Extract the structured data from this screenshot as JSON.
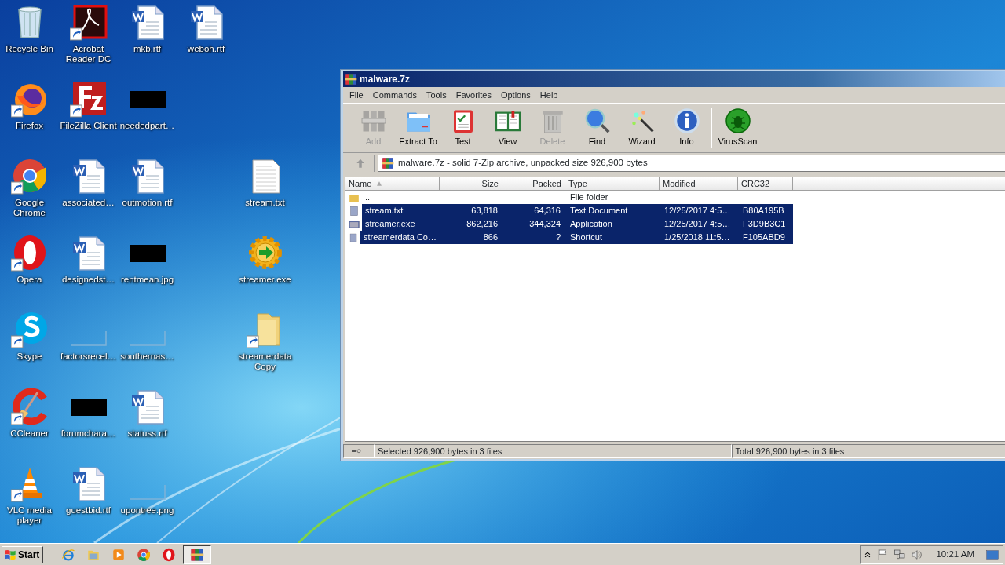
{
  "desktop_columns": [
    [
      {
        "label": "Recycle Bin",
        "kind": "recycle",
        "shortcut": false
      },
      {
        "label": "Firefox",
        "kind": "firefox",
        "shortcut": true
      },
      {
        "label": "Google Chrome",
        "kind": "chrome",
        "shortcut": true
      },
      {
        "label": "Opera",
        "kind": "opera",
        "shortcut": true
      },
      {
        "label": "Skype",
        "kind": "skype",
        "shortcut": true
      },
      {
        "label": "CCleaner",
        "kind": "ccleaner",
        "shortcut": true
      },
      {
        "label": "VLC media player",
        "kind": "vlc",
        "shortcut": true
      }
    ],
    [
      {
        "label": "Acrobat Reader DC",
        "kind": "acrobat",
        "shortcut": true
      },
      {
        "label": "FileZilla Client",
        "kind": "filezilla",
        "shortcut": true
      },
      {
        "label": "associated…",
        "kind": "word",
        "shortcut": false
      },
      {
        "label": "designedst…",
        "kind": "word",
        "shortcut": false
      },
      {
        "label": "factorsrecel…",
        "kind": "blank",
        "shortcut": false
      },
      {
        "label": "forumchara…",
        "kind": "black",
        "shortcut": false
      },
      {
        "label": "guestbid.rtf",
        "kind": "word",
        "shortcut": false
      }
    ],
    [
      {
        "label": "mkb.rtf",
        "kind": "word",
        "shortcut": false
      },
      {
        "label": "neededpart…",
        "kind": "black",
        "shortcut": false
      },
      {
        "label": "outmotion.rtf",
        "kind": "word",
        "shortcut": false
      },
      {
        "label": "rentmean.jpg",
        "kind": "black",
        "shortcut": false
      },
      {
        "label": "southernas…",
        "kind": "blank",
        "shortcut": false
      },
      {
        "label": "statuss.rtf",
        "kind": "word",
        "shortcut": false
      },
      {
        "label": "upontree.png",
        "kind": "blank",
        "shortcut": false
      }
    ],
    [
      {
        "label": "weboh.rtf",
        "kind": "word",
        "shortcut": false
      }
    ],
    [
      {
        "label": "stream.txt",
        "kind": "text",
        "shortcut": false
      },
      {
        "label": "streamer.exe",
        "kind": "gear",
        "shortcut": false
      },
      {
        "label": "streamerdata Copy",
        "kind": "folder",
        "shortcut": true
      }
    ]
  ],
  "window": {
    "title": "malware.7z",
    "menu": [
      "File",
      "Commands",
      "Tools",
      "Favorites",
      "Options",
      "Help"
    ],
    "toolbar": [
      {
        "label": "Add",
        "kind": "add",
        "disabled": true,
        "separator_before": false
      },
      {
        "label": "Extract To",
        "kind": "extract",
        "disabled": false,
        "separator_before": false
      },
      {
        "label": "Test",
        "kind": "test",
        "disabled": false,
        "separator_before": false
      },
      {
        "label": "View",
        "kind": "view",
        "disabled": false,
        "separator_before": false
      },
      {
        "label": "Delete",
        "kind": "delete",
        "disabled": true,
        "separator_before": false
      },
      {
        "label": "Find",
        "kind": "find",
        "disabled": false,
        "separator_before": false
      },
      {
        "label": "Wizard",
        "kind": "wizard",
        "disabled": false,
        "separator_before": false
      },
      {
        "label": "Info",
        "kind": "info",
        "disabled": false,
        "separator_before": false
      },
      {
        "label": "VirusScan",
        "kind": "virus",
        "disabled": false,
        "separator_before": true
      }
    ],
    "address": "malware.7z - solid 7-Zip archive, unpacked size 926,900 bytes",
    "columns": [
      {
        "label": "Name",
        "sorted": true
      },
      {
        "label": "Size",
        "sorted": false
      },
      {
        "label": "Packed",
        "sorted": false
      },
      {
        "label": "Type",
        "sorted": false
      },
      {
        "label": "Modified",
        "sorted": false
      },
      {
        "label": "CRC32",
        "sorted": false
      }
    ],
    "rows": [
      {
        "kind": "folder",
        "name": "..",
        "type": "File folder",
        "selected": false
      },
      {
        "kind": "text",
        "name": "stream.txt",
        "size": "63,818",
        "packed": "64,316",
        "type": "Text Document",
        "modified": "12/25/2017 4:5…",
        "crc32": "B80A195B",
        "selected": true
      },
      {
        "kind": "exe",
        "name": "streamer.exe",
        "size": "862,216",
        "packed": "344,324",
        "type": "Application",
        "modified": "12/25/2017 4:5…",
        "crc32": "F3D9B3C1",
        "selected": true
      },
      {
        "kind": "shortcut",
        "name": "streamerdata Co…",
        "size": "866",
        "packed": "?",
        "type": "Shortcut",
        "modified": "1/25/2018 11:5…",
        "crc32": "F105ABD9",
        "selected": true
      }
    ],
    "status_left": "Selected 926,900 bytes in 3 files",
    "status_right": "Total 926,900 bytes in 3 files"
  },
  "taskbar": {
    "start": "Start",
    "apps": [
      {
        "kind": "ie",
        "active": false
      },
      {
        "kind": "explorer",
        "active": false
      },
      {
        "kind": "media",
        "active": false
      },
      {
        "kind": "chrome",
        "active": false
      },
      {
        "kind": "opera",
        "active": false
      },
      {
        "kind": "winrar",
        "active": true
      }
    ],
    "clock": "10:21 AM"
  }
}
